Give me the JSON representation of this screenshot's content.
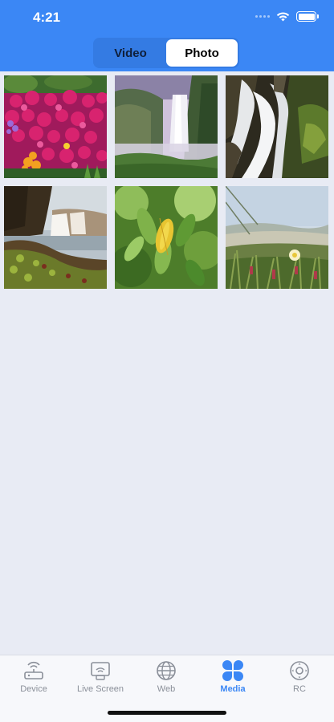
{
  "status_bar": {
    "time": "4:21"
  },
  "segments": [
    {
      "label": "Video",
      "selected": false
    },
    {
      "label": "Photo",
      "selected": true
    }
  ],
  "photos": [
    {
      "name": "flowers"
    },
    {
      "name": "waterfall-valley"
    },
    {
      "name": "waterfall-rocks"
    },
    {
      "name": "waterfall-shore"
    },
    {
      "name": "green-leaves"
    },
    {
      "name": "beach-grass"
    }
  ],
  "tabbar": {
    "tabs": [
      {
        "label": "Device",
        "icon": "router-icon"
      },
      {
        "label": "Live Screen",
        "icon": "screen-cast-icon"
      },
      {
        "label": "Web",
        "icon": "globe-icon"
      },
      {
        "label": "Media",
        "icon": "media-grid-icon"
      },
      {
        "label": "RC",
        "icon": "remote-control-icon"
      }
    ],
    "active": "Media"
  },
  "colors": {
    "header": "#3b87f5",
    "accent": "#3b87f5",
    "background": "#e8ebf4"
  }
}
